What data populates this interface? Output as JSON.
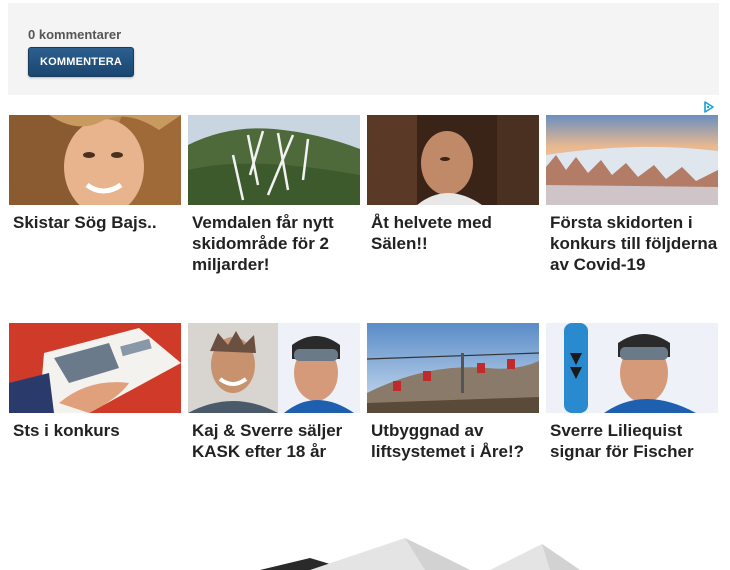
{
  "comments": {
    "count_label": "0 kommentarer",
    "button_label": "KOMMENTERA"
  },
  "ad_choices_icon": "adchoices-icon",
  "articles": [
    {
      "title": "Skistar Sög Bajs.."
    },
    {
      "title": "Vemdalen får nytt skidområde för 2 miljarder!"
    },
    {
      "title": "Åt helvete med Sälen!!"
    },
    {
      "title": "Första skidorten i konkurs till följderna av Covid-19"
    },
    {
      "title": "Sts i konkurs"
    },
    {
      "title": "Kaj & Sverre säljer KASK efter 18 år"
    },
    {
      "title": "Utbyggnad av liftsystemet i Åre!?"
    },
    {
      "title": "Sverre Liliequist signar för Fischer"
    }
  ],
  "colors": {
    "button_bg": "#1b4670",
    "comment_bg": "#f4f4f4",
    "title_text": "#222222"
  }
}
